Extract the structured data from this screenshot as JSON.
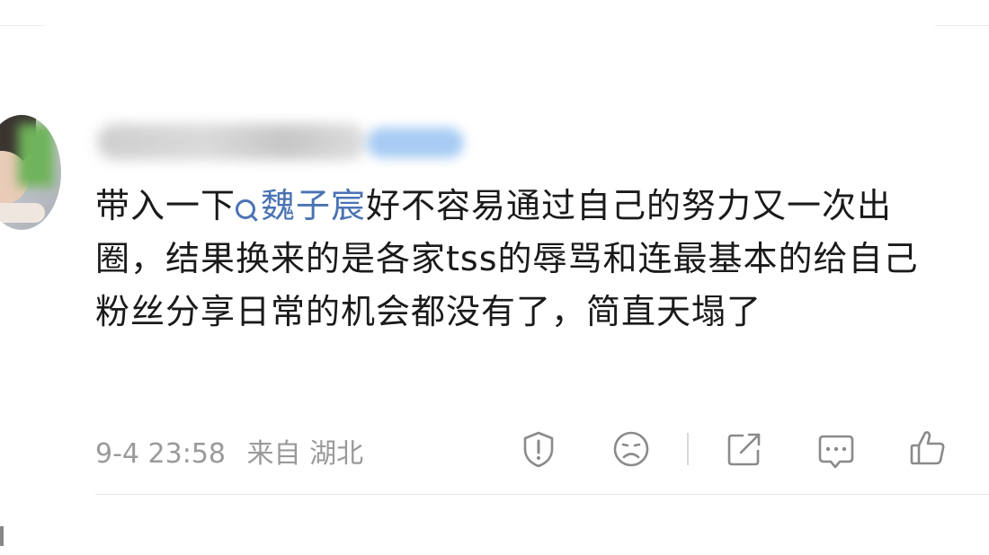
{
  "post": {
    "content_before_topic": "带入一下",
    "topic": "魏子宸",
    "content_after_topic": "好不容易通过自己的努力又一次出圈，结果换来的是各家tss的辱骂和连最基本的给自己粉丝分享日常的机会都没有了，简直天塌了",
    "date": "9-4 23:58",
    "source": "来自 湖北"
  },
  "actions": [
    {
      "name": "report",
      "icon": "exclamation-shield-icon"
    },
    {
      "name": "dislike",
      "icon": "frown-face-icon"
    },
    {
      "name": "share",
      "icon": "share-arrow-icon"
    },
    {
      "name": "comment",
      "icon": "comment-bubble-icon"
    },
    {
      "name": "like",
      "icon": "thumbs-up-icon"
    }
  ]
}
